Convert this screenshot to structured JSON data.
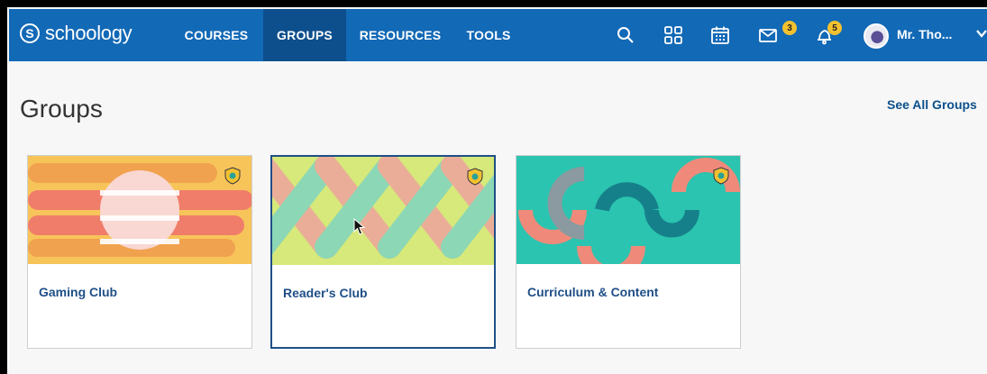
{
  "topbar": {
    "logo_text": "schoology",
    "logo_mark": "S",
    "nav": [
      {
        "label": "COURSES",
        "active": false
      },
      {
        "label": "GROUPS",
        "active": true
      },
      {
        "label": "RESOURCES",
        "active": false
      },
      {
        "label": "TOOLS",
        "active": false
      }
    ],
    "icons": {
      "search": "search-icon",
      "apps": "apps-grid-icon",
      "calendar": "calendar-icon",
      "messages": "envelope-icon",
      "notifications": "bell-icon"
    },
    "messages_badge": "3",
    "notifications_badge": "5",
    "user_name": "Mr. Tho..."
  },
  "page": {
    "title": "Groups",
    "see_all": "See All Groups"
  },
  "groups": [
    {
      "name": "Gaming Club"
    },
    {
      "name": "Reader's Club"
    },
    {
      "name": "Curriculum & Content"
    }
  ],
  "colors": {
    "brand": "#1269b6",
    "nav_active": "#0d4f8c",
    "link": "#1f4f87",
    "badge": "#f3c12f"
  }
}
